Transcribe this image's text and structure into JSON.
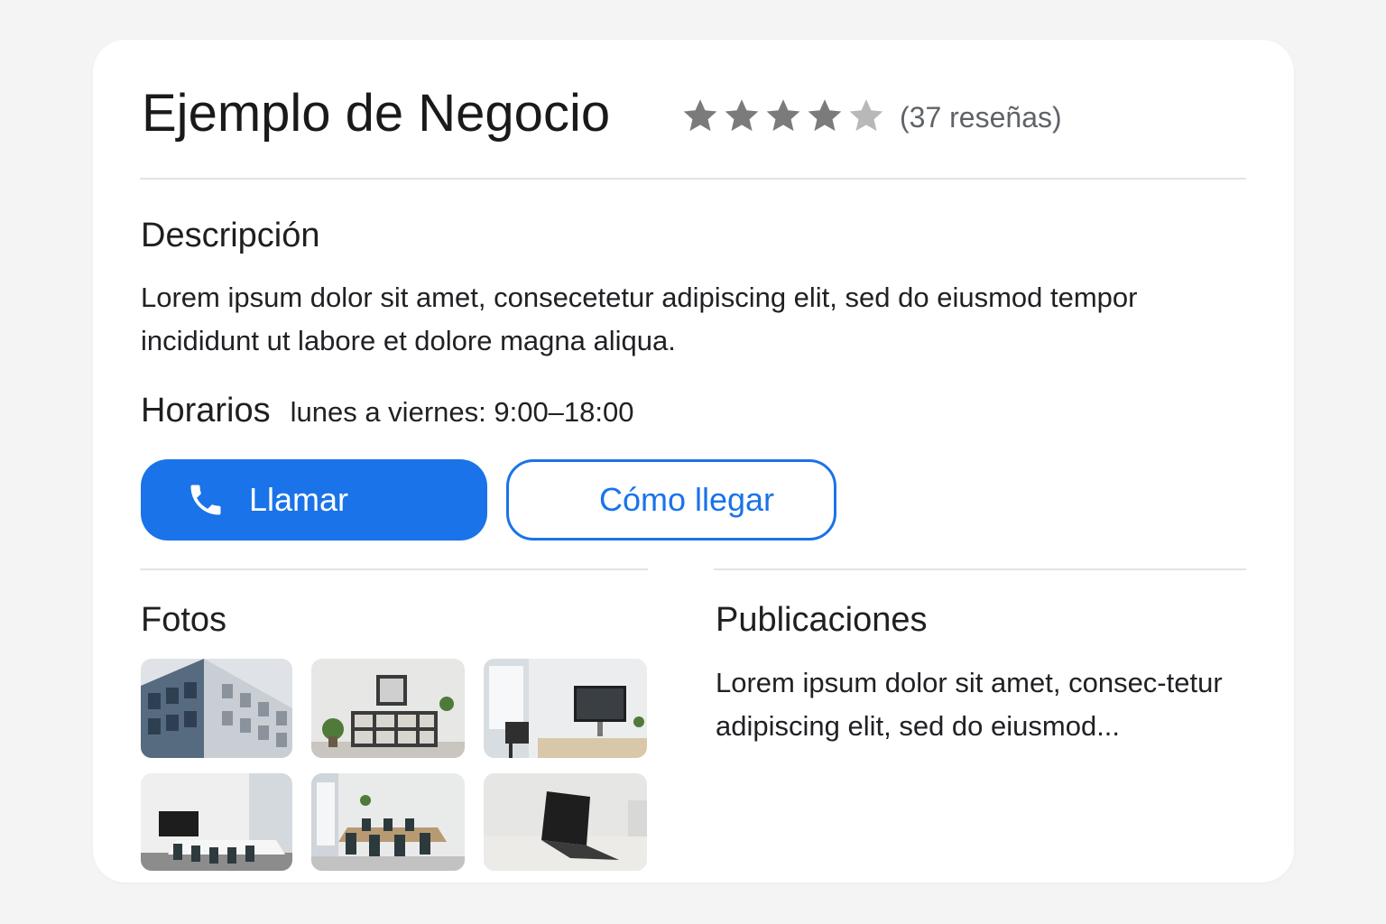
{
  "business": {
    "name": "Ejemplo de Negocio",
    "rating": 4,
    "rating_max": 5,
    "reviews": "(37 reseñas)"
  },
  "description": {
    "heading": "Descripción",
    "text": "Lorem ipsum dolor sit amet, consecetetur adipiscing elit, sed do eiusmod tempor incididunt ut labore et dolore magna aliqua."
  },
  "hours": {
    "label": "Horarios",
    "value": "lunes a viernes: 9:00–18:00"
  },
  "actions": {
    "call_label": "Llamar",
    "call_icon": "phone-icon",
    "directions_label": "Cómo llegar"
  },
  "photos": {
    "heading": "Fotos",
    "items": [
      "office-building-exterior",
      "shelving-room",
      "desk-with-monitor",
      "meeting-room-with-screen",
      "conference-table-room",
      "laptop-on-desk"
    ]
  },
  "posts": {
    "heading": "Publicaciones",
    "text": "Lorem ipsum dolor sit amet, consec-tetur adipiscing elit, sed do eiusmod..."
  },
  "colors": {
    "accent": "#1a73e8",
    "star": "#7b7b7b",
    "star_empty": "#b8b8b8",
    "divider": "#e3e3e3",
    "background": "#f4f4f4",
    "card": "#ffffff"
  }
}
